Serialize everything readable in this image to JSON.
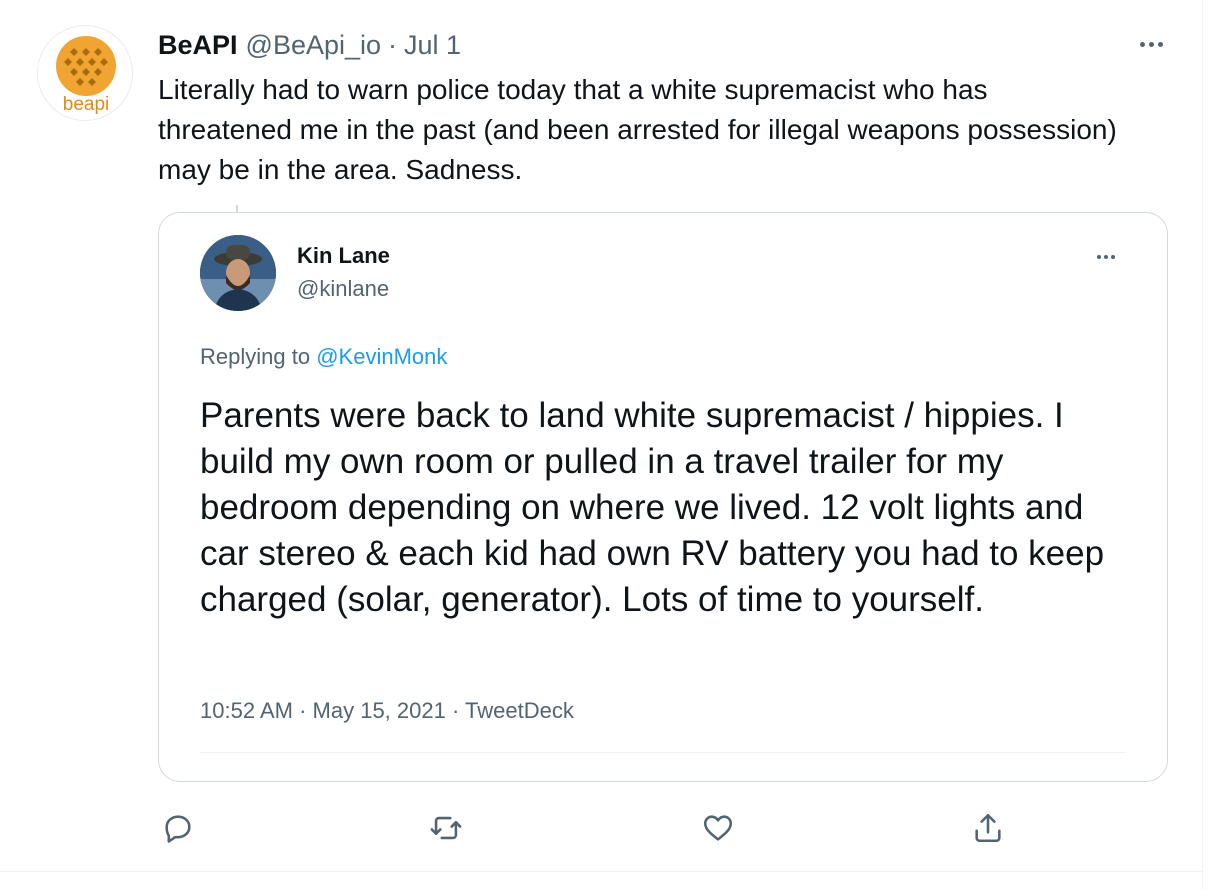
{
  "tweet": {
    "author": {
      "display_name": "BeAPI",
      "handle": "@BeApi_io",
      "avatar_text": "beapi",
      "avatar_color": "#f0a431"
    },
    "separator": "·",
    "date": "Jul 1",
    "text": "Literally had to warn police today that a white supremacist who has threatened me in the past (and been arrested for illegal weapons possession) may be in the area. Sadness.",
    "more_icon": "more-horizontal-icon"
  },
  "quoted_tweet": {
    "author": {
      "display_name": "Kin Lane",
      "handle": "@kinlane"
    },
    "replying_prefix": "Replying to",
    "replying_to": "@KevinMonk",
    "text": "Parents were back to land white supremacist / hippies. I build my own room or pulled in a travel trailer for my bedroom depending on where we lived. 12 volt lights and car stereo & each kid had own RV battery you had to keep charged (solar, generator). Lots of time to yourself.",
    "time": "10:52 AM",
    "separator": "·",
    "date": "May 15, 2021",
    "source": "TweetDeck",
    "more_icon": "more-horizontal-icon"
  },
  "actions": [
    {
      "name": "reply-icon"
    },
    {
      "name": "retweet-icon"
    },
    {
      "name": "like-icon"
    },
    {
      "name": "share-icon"
    }
  ],
  "colors": {
    "text_primary": "#0f1419",
    "text_secondary": "#536471",
    "link": "#1d9bf0",
    "border": "#cfd9de"
  }
}
